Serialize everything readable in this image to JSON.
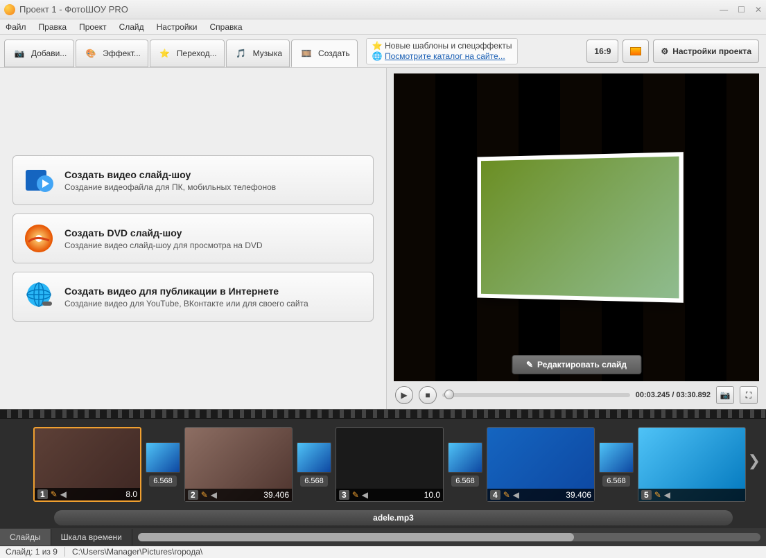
{
  "window": {
    "title": "Проект 1 - ФотоШОУ PRO"
  },
  "menu": [
    "Файл",
    "Правка",
    "Проект",
    "Слайд",
    "Настройки",
    "Справка"
  ],
  "tabs": [
    {
      "label": "Добави...",
      "icon": "camera"
    },
    {
      "label": "Эффект...",
      "icon": "palette"
    },
    {
      "label": "Переход...",
      "icon": "star"
    },
    {
      "label": "Музыка",
      "icon": "music"
    },
    {
      "label": "Создать",
      "icon": "film",
      "active": true
    }
  ],
  "notice": {
    "line1": "Новые шаблоны и спецэффекты",
    "line2": "Посмотрите каталог на сайте..."
  },
  "header_buttons": {
    "aspect": "16:9",
    "settings": "Настройки проекта"
  },
  "create_cards": [
    {
      "title": "Создать видео слайд-шоу",
      "desc": "Создание видеофайла для ПК, мобильных телефонов",
      "icon": "video"
    },
    {
      "title": "Создать DVD слайд-шоу",
      "desc": "Создание видео слайд-шоу для просмотра на DVD",
      "icon": "dvd"
    },
    {
      "title": "Создать видео для публикации в Интернете",
      "desc": "Создание видео для YouTube, ВКонтакте или для своего сайта",
      "icon": "globe"
    }
  ],
  "preview": {
    "edit_button": "Редактировать слайд",
    "time": "00:03.245 / 03:30.892"
  },
  "slides": [
    {
      "num": "1",
      "duration": "8.0",
      "selected": true
    },
    {
      "num": "2",
      "duration": "39.406"
    },
    {
      "num": "3",
      "duration": "10.0"
    },
    {
      "num": "4",
      "duration": "39.406"
    },
    {
      "num": "5",
      "duration": ""
    }
  ],
  "transitions": [
    {
      "time": "6.568"
    },
    {
      "time": "6.568"
    },
    {
      "time": "6.568"
    },
    {
      "time": "6.568"
    }
  ],
  "audio_track": "adele.mp3",
  "view_tabs": {
    "slides": "Слайды",
    "timeline": "Шкала времени"
  },
  "status": {
    "slide": "Слайд: 1 из 9",
    "path": "C:\\Users\\Manager\\Pictures\\города\\"
  }
}
